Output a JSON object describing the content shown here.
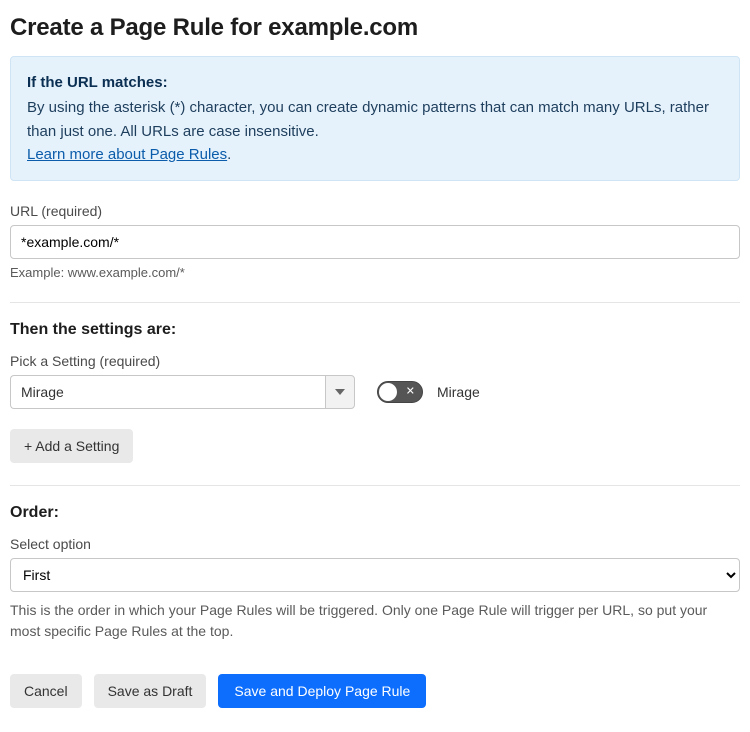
{
  "title": "Create a Page Rule for example.com",
  "info": {
    "heading": "If the URL matches:",
    "body": "By using the asterisk (*) character, you can create dynamic patterns that can match many URLs, rather than just one. All URLs are case insensitive.",
    "link_text": "Learn more about Page Rules",
    "link_suffix": "."
  },
  "url_field": {
    "label": "URL (required)",
    "value": "*example.com/*",
    "hint": "Example: www.example.com/*"
  },
  "settings": {
    "heading": "Then the settings are:",
    "pick_label": "Pick a Setting (required)",
    "selected": "Mirage",
    "toggle_label": "Mirage",
    "toggle_on": false,
    "add_label": "+ Add a Setting"
  },
  "order": {
    "heading": "Order:",
    "select_label": "Select option",
    "selected": "First",
    "description": "This is the order in which your Page Rules will be triggered. Only one Page Rule will trigger per URL, so put your most specific Page Rules at the top."
  },
  "footer": {
    "cancel": "Cancel",
    "draft": "Save as Draft",
    "deploy": "Save and Deploy Page Rule"
  }
}
